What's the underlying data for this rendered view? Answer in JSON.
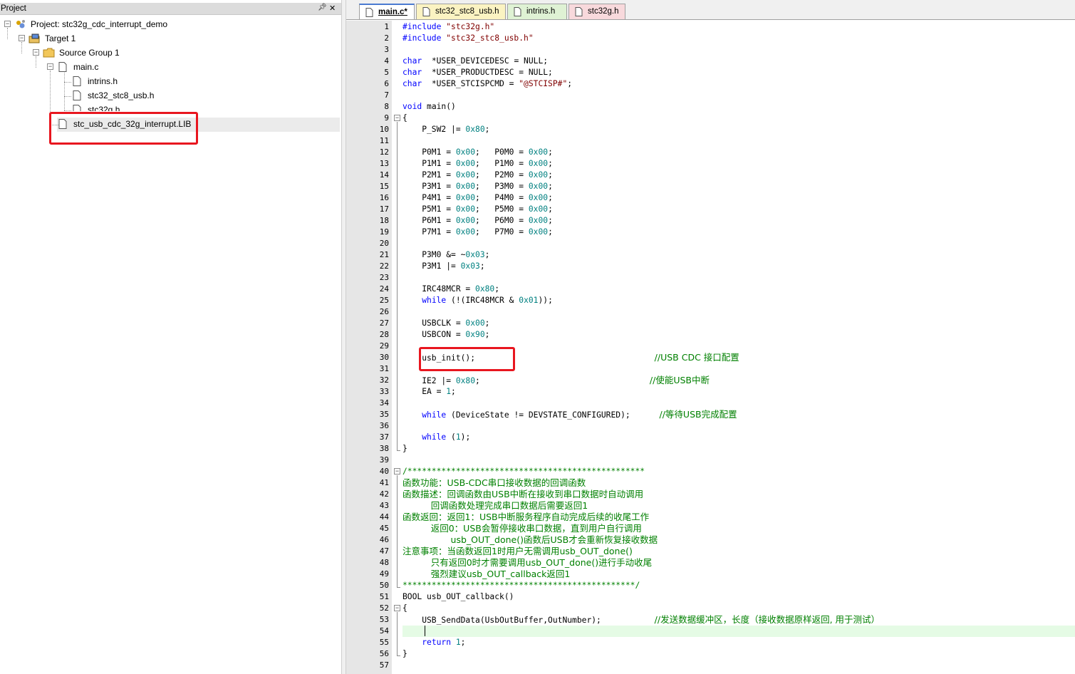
{
  "project_pane": {
    "title": "Project",
    "tree": {
      "project": "Project: stc32g_cdc_interrupt_demo",
      "target": "Target 1",
      "group": "Source Group 1",
      "main": "main.c",
      "children": [
        "intrins.h",
        "stc32_stc8_usb.h",
        "stc32g.h"
      ],
      "lib": "stc_usb_cdc_32g_interrupt.LIB"
    }
  },
  "tabs": [
    {
      "label": "main.c*",
      "active": true
    },
    {
      "label": "stc32_stc8_usb.h",
      "active": false
    },
    {
      "label": "intrins.h",
      "active": false
    },
    {
      "label": "stc32g.h",
      "active": false
    }
  ],
  "editor": {
    "line_numbers": [
      "1",
      "2",
      "3",
      "4",
      "5",
      "6",
      "7",
      "8",
      "9",
      "10",
      "11",
      "12",
      "13",
      "14",
      "15",
      "16",
      "17",
      "18",
      "19",
      "20",
      "21",
      "22",
      "23",
      "24",
      "25",
      "26",
      "27",
      "28",
      "29",
      "30",
      "31",
      "32",
      "33",
      "34",
      "35",
      "36",
      "37",
      "38",
      "39",
      "40",
      "41",
      "42",
      "43",
      "44",
      "45",
      "46",
      "47",
      "48",
      "49",
      "50",
      "51",
      "52",
      "53",
      "54",
      "55",
      "56",
      "57"
    ],
    "current_line": 54,
    "lines": [
      [
        [
          "kw",
          "#include "
        ],
        [
          "str",
          "\"stc32g.h\""
        ]
      ],
      [
        [
          "kw",
          "#include "
        ],
        [
          "str",
          "\"stc32_stc8_usb.h\""
        ]
      ],
      [],
      [
        [
          "kw",
          "char"
        ],
        [
          "",
          "  *USER_DEVICEDESC = NULL;"
        ]
      ],
      [
        [
          "kw",
          "char"
        ],
        [
          "",
          "  *USER_PRODUCTDESC = NULL;"
        ]
      ],
      [
        [
          "kw",
          "char"
        ],
        [
          "",
          "  *USER_STCISPCMD = "
        ],
        [
          "str",
          "\"@STCISP#\""
        ],
        [
          "",
          ";"
        ]
      ],
      [],
      [
        [
          "kw",
          "void"
        ],
        [
          "",
          " main()"
        ]
      ],
      [
        [
          "",
          "{"
        ]
      ],
      [
        [
          "",
          "    P_SW2 |= "
        ],
        [
          "num",
          "0x80"
        ],
        [
          "",
          ";"
        ]
      ],
      [],
      [
        [
          "",
          "    P0M1 = "
        ],
        [
          "num",
          "0x00"
        ],
        [
          "",
          ";   P0M0 = "
        ],
        [
          "num",
          "0x00"
        ],
        [
          "",
          ";"
        ]
      ],
      [
        [
          "",
          "    P1M1 = "
        ],
        [
          "num",
          "0x00"
        ],
        [
          "",
          ";   P1M0 = "
        ],
        [
          "num",
          "0x00"
        ],
        [
          "",
          ";"
        ]
      ],
      [
        [
          "",
          "    P2M1 = "
        ],
        [
          "num",
          "0x00"
        ],
        [
          "",
          ";   P2M0 = "
        ],
        [
          "num",
          "0x00"
        ],
        [
          "",
          ";"
        ]
      ],
      [
        [
          "",
          "    P3M1 = "
        ],
        [
          "num",
          "0x00"
        ],
        [
          "",
          ";   P3M0 = "
        ],
        [
          "num",
          "0x00"
        ],
        [
          "",
          ";"
        ]
      ],
      [
        [
          "",
          "    P4M1 = "
        ],
        [
          "num",
          "0x00"
        ],
        [
          "",
          ";   P4M0 = "
        ],
        [
          "num",
          "0x00"
        ],
        [
          "",
          ";"
        ]
      ],
      [
        [
          "",
          "    P5M1 = "
        ],
        [
          "num",
          "0x00"
        ],
        [
          "",
          ";   P5M0 = "
        ],
        [
          "num",
          "0x00"
        ],
        [
          "",
          ";"
        ]
      ],
      [
        [
          "",
          "    P6M1 = "
        ],
        [
          "num",
          "0x00"
        ],
        [
          "",
          ";   P6M0 = "
        ],
        [
          "num",
          "0x00"
        ],
        [
          "",
          ";"
        ]
      ],
      [
        [
          "",
          "    P7M1 = "
        ],
        [
          "num",
          "0x00"
        ],
        [
          "",
          ";   P7M0 = "
        ],
        [
          "num",
          "0x00"
        ],
        [
          "",
          ";"
        ]
      ],
      [],
      [
        [
          "",
          "    P3M0 &= ~"
        ],
        [
          "num",
          "0x03"
        ],
        [
          "",
          ";"
        ]
      ],
      [
        [
          "",
          "    P3M1 |= "
        ],
        [
          "num",
          "0x03"
        ],
        [
          "",
          ";"
        ]
      ],
      [],
      [
        [
          "",
          "    IRC48MCR = "
        ],
        [
          "num",
          "0x80"
        ],
        [
          "",
          ";"
        ]
      ],
      [
        [
          "",
          "    "
        ],
        [
          "kw",
          "while"
        ],
        [
          "",
          " (!(IRC48MCR & "
        ],
        [
          "num",
          "0x01"
        ],
        [
          "",
          "));"
        ]
      ],
      [],
      [
        [
          "",
          "    USBCLK = "
        ],
        [
          "num",
          "0x00"
        ],
        [
          "",
          ";"
        ]
      ],
      [
        [
          "",
          "    USBCON = "
        ],
        [
          "num",
          "0x90"
        ],
        [
          "",
          ";"
        ]
      ],
      [],
      [
        [
          "",
          "    usb_init();                                     "
        ],
        [
          "cm",
          "//USB CDC 接口配置"
        ]
      ],
      [],
      [
        [
          "",
          "    IE2 |= "
        ],
        [
          "num",
          "0x80"
        ],
        [
          "",
          ";                                   "
        ],
        [
          "cm",
          "//使能USB中断"
        ]
      ],
      [
        [
          "",
          "    EA = "
        ],
        [
          "num",
          "1"
        ],
        [
          "",
          ";"
        ]
      ],
      [],
      [
        [
          "",
          "    "
        ],
        [
          "kw",
          "while"
        ],
        [
          "",
          " (DeviceState != DEVSTATE_CONFIGURED);      "
        ],
        [
          "cm",
          "//等待USB完成配置"
        ]
      ],
      [],
      [
        [
          "",
          "    "
        ],
        [
          "kw",
          "while"
        ],
        [
          "",
          " ("
        ],
        [
          "num",
          "1"
        ],
        [
          "",
          ");"
        ]
      ],
      [
        [
          "",
          "}"
        ]
      ],
      [],
      [
        [
          "cm",
          "/*************************************************"
        ]
      ],
      [
        [
          "cm",
          "函数功能：USB-CDC串口接收数据的回调函数"
        ]
      ],
      [
        [
          "cm",
          "函数描述：回调函数由USB中断在接收到串口数据时自动调用"
        ]
      ],
      [
        [
          "cm",
          "          回调函数处理完成串口数据后需要返回1"
        ]
      ],
      [
        [
          "cm",
          "函数返回：返回1：USB中断服务程序自动完成后续的收尾工作"
        ]
      ],
      [
        [
          "cm",
          "          返回0：USB会暂停接收串口数据，直到用户自行调用"
        ]
      ],
      [
        [
          "cm",
          "                 usb_OUT_done()函数后USB才会重新恢复接收数据"
        ]
      ],
      [
        [
          "cm",
          "注意事项：当函数返回1时用户无需调用usb_OUT_done()"
        ]
      ],
      [
        [
          "cm",
          "          只有返回0时才需要调用usb_OUT_done()进行手动收尾"
        ]
      ],
      [
        [
          "cm",
          "          强烈建议usb_OUT_callback返回1"
        ]
      ],
      [
        [
          "cm",
          "************************************************/"
        ]
      ],
      [
        [
          "",
          "BOOL usb_OUT_callback()"
        ]
      ],
      [
        [
          "",
          "{"
        ]
      ],
      [
        [
          "",
          "    USB_SendData(UsbOutBuffer,OutNumber);           "
        ],
        [
          "cm",
          "//发送数据缓冲区，长度（接收数据原样返回, 用于测试）"
        ]
      ],
      [],
      [
        [
          "",
          "    "
        ],
        [
          "kw",
          "return"
        ],
        [
          "",
          " "
        ],
        [
          "num",
          "1"
        ],
        [
          "",
          ";"
        ]
      ],
      [
        [
          "",
          "}"
        ]
      ],
      []
    ]
  }
}
